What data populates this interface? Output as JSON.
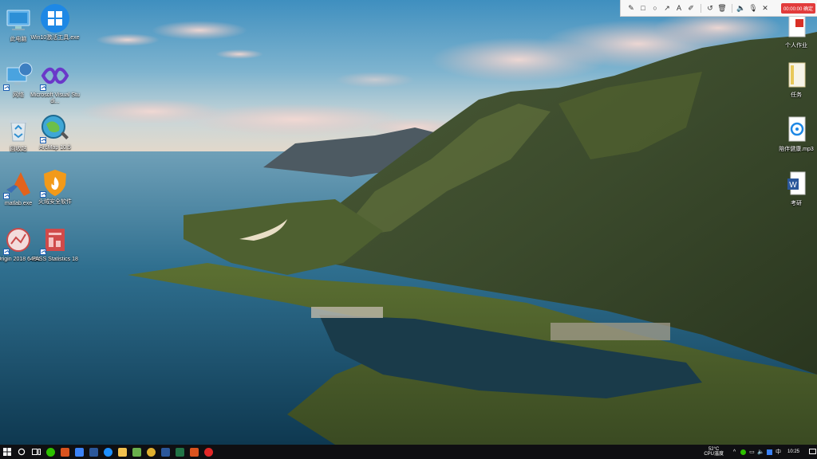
{
  "desktop": {
    "left_icons": [
      {
        "id": "this-pc",
        "label": "此电脑",
        "shortcut": false
      },
      {
        "id": "win10-activator",
        "label": "Win10激活工具.exe",
        "shortcut": false
      },
      {
        "id": "network",
        "label": "网络",
        "shortcut": true
      },
      {
        "id": "visual-studio",
        "label": "Microsoft Visual Studi...",
        "shortcut": true
      },
      {
        "id": "recycle-bin",
        "label": "回收站",
        "shortcut": false
      },
      {
        "id": "arcmap",
        "label": "ArcMap 10.5",
        "shortcut": true
      },
      {
        "id": "matlab",
        "label": "matlab.exe",
        "shortcut": true
      },
      {
        "id": "huorong",
        "label": "火绒安全软件",
        "shortcut": true
      },
      {
        "id": "origin",
        "label": "Origin 2018 64Bit",
        "shortcut": true
      },
      {
        "id": "pass",
        "label": "PASS Statistics 18",
        "shortcut": true
      }
    ],
    "right_icons": [
      {
        "id": "personal-work",
        "label": "个人作业"
      },
      {
        "id": "tasks-folder",
        "label": "任务"
      },
      {
        "id": "mp3-file",
        "label": "陪伴健康.mp3"
      },
      {
        "id": "kaoyan-doc",
        "label": "考研"
      }
    ]
  },
  "recorder": {
    "tools": [
      {
        "name": "pen-icon",
        "glyph": "✎"
      },
      {
        "name": "rectangle-icon",
        "glyph": "□"
      },
      {
        "name": "ellipse-icon",
        "glyph": "○"
      },
      {
        "name": "arrow-icon",
        "glyph": "↗"
      },
      {
        "name": "text-icon",
        "glyph": "A"
      },
      {
        "name": "highlighter-icon",
        "glyph": "✐"
      },
      {
        "name": "undo-icon",
        "glyph": "↺"
      },
      {
        "name": "delete-icon",
        "glyph": "🗑"
      },
      {
        "name": "speaker-icon",
        "glyph": "🔈"
      },
      {
        "name": "microphone-icon",
        "glyph": "🎙"
      },
      {
        "name": "close-icon",
        "glyph": "✕"
      }
    ],
    "timer": "00:00:00 确定"
  },
  "taskbar": {
    "apps": [
      {
        "name": "wechat",
        "color": "#2dc100"
      },
      {
        "name": "matlab",
        "color": "#d9531e"
      },
      {
        "name": "screen-recorder",
        "color": "#3b82f6"
      },
      {
        "name": "word-app",
        "color": "#2b579a"
      },
      {
        "name": "edge",
        "color": "#1e90ff"
      },
      {
        "name": "file-explorer",
        "color": "#f2c14e"
      },
      {
        "name": "photos",
        "color": "#6ab04c"
      },
      {
        "name": "chrome",
        "color": "#e0b030"
      },
      {
        "name": "word-doc",
        "color": "#2b579a"
      },
      {
        "name": "excel",
        "color": "#217346"
      },
      {
        "name": "matlab-2",
        "color": "#d9531e"
      },
      {
        "name": "netease-music",
        "color": "#e22727"
      }
    ],
    "weather_temp": "52°C",
    "weather_label": "CPU温度",
    "clock": "10:25",
    "input_method": "中"
  },
  "colors": {
    "accent": "#0078d7",
    "recorder_red": "#e23b3b"
  }
}
